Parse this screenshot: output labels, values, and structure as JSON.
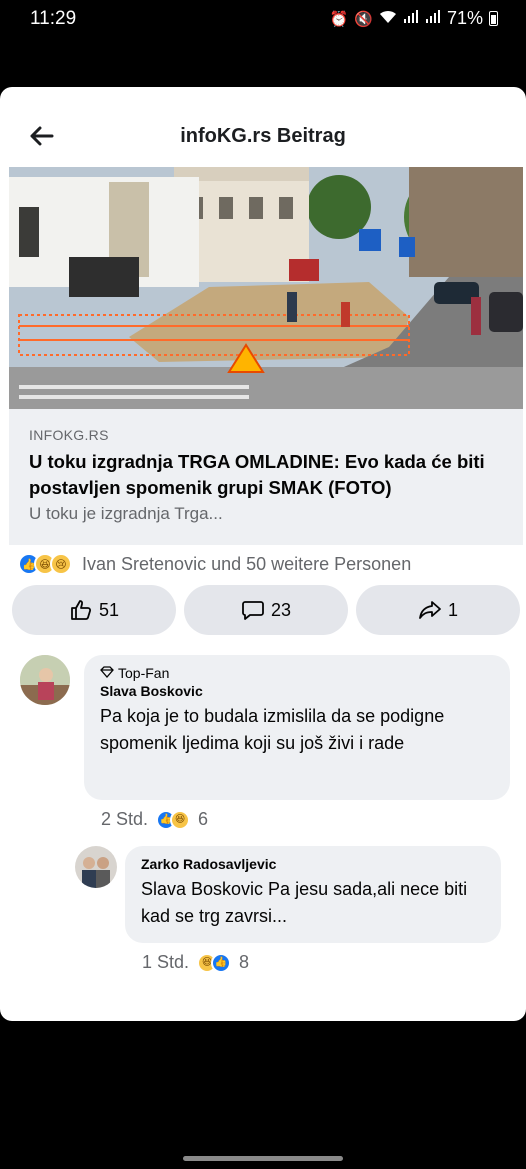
{
  "status_bar": {
    "time": "11:29",
    "battery": "71%"
  },
  "header": {
    "title": "infoKG.rs Beitrag"
  },
  "link_preview": {
    "domain": "INFOKG.RS",
    "title": "U toku izgradnja TRGA OMLADINE: Evo kada će biti postavljen spomenik grupi SMAK (FOTO)",
    "description": "U toku je izgradnja Trga..."
  },
  "reactions": {
    "summary": "Ivan Sretenovic und 50 weitere Personen",
    "icons": [
      "like-icon",
      "haha-icon",
      "sad-icon"
    ]
  },
  "actions": {
    "like_count": "51",
    "comment_count": "23",
    "share_count": "1"
  },
  "comments": [
    {
      "badge": "Top-Fan",
      "author": "Slava Boskovic",
      "text": "Pa koja je to budala izmislila da se podigne spomenik ljedima koji su još živi i rade",
      "time": "2 Std.",
      "reaction_count": "6"
    },
    {
      "author": "Zarko Radosavljevic",
      "text": "Slava Boskovic Pa jesu sada,ali nece biti kad se trg zavrsi...",
      "time": "1 Std.",
      "reaction_count": "8"
    }
  ],
  "colors": {
    "accent": "#1877f2",
    "bubble": "#eef0f3",
    "secondary_text": "#65676b"
  }
}
